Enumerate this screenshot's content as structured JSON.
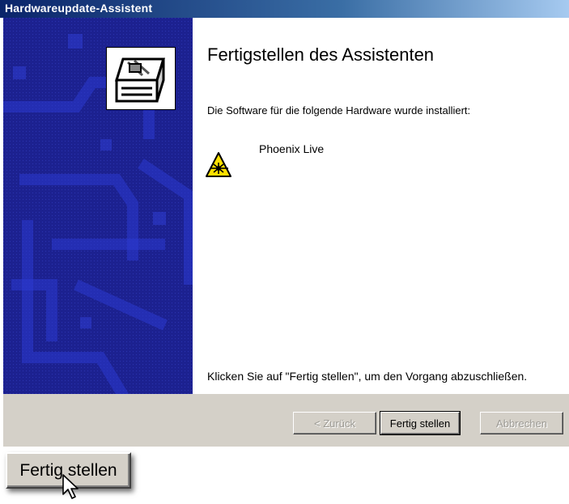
{
  "window": {
    "title": "Hardwareupdate-Assistent"
  },
  "main": {
    "heading": "Fertigstellen des Assistenten",
    "description": "Die Software für die folgende Hardware wurde installiert:",
    "device_name": "Phoenix Live",
    "device_icon": "laser-warning-icon",
    "finish_hint": "Klicken Sie auf \"Fertig stellen\", um den Vorgang abzuschließen."
  },
  "buttons": {
    "back": "< Zurück",
    "finish": "Fertig stellen",
    "cancel": "Abbrechen"
  },
  "zoom_callout": {
    "label": "Fertig stellen",
    "cursor_icon": "arrow-cursor-icon"
  },
  "colors": {
    "title_start": "#0a246a",
    "title_end": "#a6caf0",
    "panel": "#1a1f8a",
    "face": "#d4d0c8"
  }
}
